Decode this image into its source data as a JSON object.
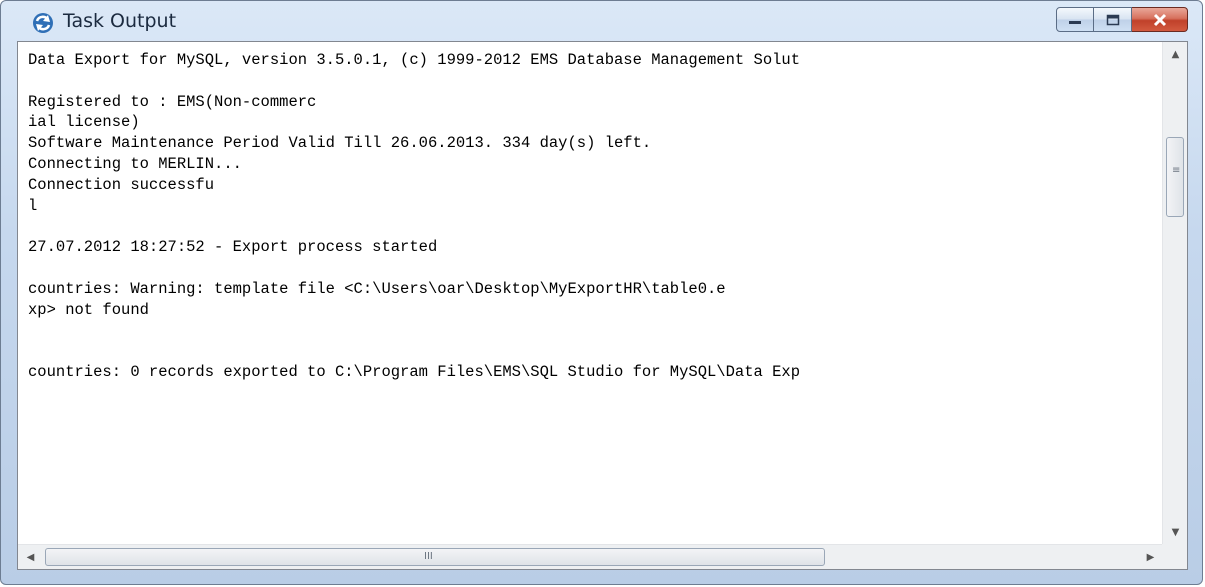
{
  "window": {
    "title": "Task Output",
    "icon": "refresh-arrows-icon",
    "controls": {
      "minimize": "minimize-icon",
      "maximize": "maximize-icon",
      "close": "close-icon"
    }
  },
  "output": {
    "lines": [
      "Data Export for MySQL, version 3.5.0.1, (c) 1999-2012 EMS Database Management Solut",
      "",
      "Registered to : EMS(Non-commerc",
      "ial license)",
      "Software Maintenance Period Valid Till 26.06.2013. 334 day(s) left.",
      "Connecting to MERLIN...",
      "Connection successfu",
      "l",
      "",
      "27.07.2012 18:27:52 - Export process started",
      "",
      "countries: Warning: template file <C:\\Users\\oar\\Desktop\\MyExportHR\\table0.e",
      "xp> not found",
      "",
      "",
      "countries: 0 records exported to C:\\Program Files\\EMS\\SQL Studio for MySQL\\Data Exp"
    ]
  },
  "scrollbars": {
    "vertical_grip": "≡",
    "horizontal_grip": "III",
    "up_arrow": "▲",
    "down_arrow": "▼",
    "left_arrow": "◀",
    "right_arrow": "▶"
  }
}
